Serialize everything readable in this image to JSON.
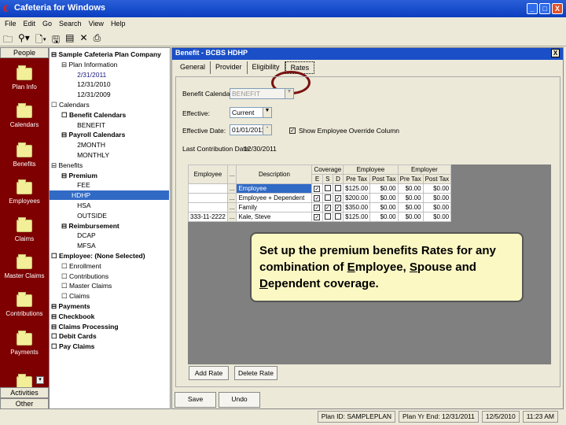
{
  "window": {
    "title": "Cafeteria for Windows",
    "controls": [
      "_",
      "□",
      "X"
    ]
  },
  "menu": [
    "File",
    "Edit",
    "Go",
    "Search",
    "View",
    "Help"
  ],
  "sidebar": {
    "header": "People",
    "items": [
      "Plan Info",
      "Calendars",
      "Benefits",
      "Employees",
      "Claims",
      "Master Claims",
      "Contributions",
      "Payments"
    ],
    "bottom": [
      "Activities",
      "Other"
    ]
  },
  "tree": [
    {
      "t": "Sample Cafeteria Plan Company",
      "l": 0,
      "b": true,
      "e": "⊟"
    },
    {
      "t": "Plan Information",
      "l": 1,
      "e": "⊟"
    },
    {
      "t": "2/31/2011",
      "l": 2,
      "c": "#1a1a80"
    },
    {
      "t": "12/31/2010",
      "l": 2
    },
    {
      "t": "12/31/2009",
      "l": 2
    },
    {
      "t": "Calendars",
      "l": 0,
      "e": "☐"
    },
    {
      "t": "Benefit Calendars",
      "l": 1,
      "b": true,
      "e": "☐"
    },
    {
      "t": "BENEFIT",
      "l": 2
    },
    {
      "t": "Payroll Calendars",
      "l": 1,
      "b": true,
      "e": "⊟"
    },
    {
      "t": "2MONTH",
      "l": 2
    },
    {
      "t": "MONTHLY",
      "l": 2
    },
    {
      "t": "Benefits",
      "l": 0,
      "e": "⊟"
    },
    {
      "t": "Premium",
      "l": 1,
      "b": true,
      "e": "⊟"
    },
    {
      "t": "FEE",
      "l": 2
    },
    {
      "t": "HDHP",
      "l": 2,
      "sel": true
    },
    {
      "t": "HSA",
      "l": 2
    },
    {
      "t": "OUTSIDE",
      "l": 2
    },
    {
      "t": "Reimbursement",
      "l": 1,
      "b": true,
      "e": "⊟"
    },
    {
      "t": "DCAP",
      "l": 2
    },
    {
      "t": "MFSA",
      "l": 2
    },
    {
      "t": "Employee: (None Selected)",
      "l": 0,
      "b": true,
      "e": "☐"
    },
    {
      "t": "Enrollment",
      "l": 1,
      "e": "☐"
    },
    {
      "t": "Contributions",
      "l": 1,
      "e": "☐"
    },
    {
      "t": "Master Claims",
      "l": 1,
      "e": "☐"
    },
    {
      "t": "Claims",
      "l": 1,
      "e": "☐"
    },
    {
      "t": "Payments",
      "l": 0,
      "b": true,
      "e": "⊟"
    },
    {
      "t": "Checkbook",
      "l": 0,
      "b": true,
      "e": "⊟"
    },
    {
      "t": "Claims Processing",
      "l": 0,
      "b": true,
      "e": "⊟"
    },
    {
      "t": "Debit Cards",
      "l": 0,
      "b": true,
      "e": "☐"
    },
    {
      "t": "Pay Claims",
      "l": 0,
      "b": true,
      "e": "☐"
    }
  ],
  "panel": {
    "title": "Benefit - BCBS HDHP",
    "close": "X",
    "tabs": [
      "General",
      "Provider",
      "Eligibility",
      "Rates"
    ],
    "form": {
      "calendar_label": "Benefit Calendar:",
      "calendar_value": "BENEFIT",
      "effective_label": "Effective:",
      "effective_value": "Current",
      "date_label": "Effective Date:",
      "date_value": "01/01/2011",
      "override_label": "Show Employee Override Column",
      "last_label": "Last Contribution Date:",
      "last_value": "12/30/2011"
    },
    "grid": {
      "headers": {
        "employee": "Employee",
        "dots": "...",
        "description": "Description",
        "coverage": "Coverage",
        "employee_grp": "Employee",
        "employer_grp": "Employer",
        "e": "E",
        "s": "S",
        "d": "D",
        "pre": "Pre Tax",
        "post": "Post Tax"
      },
      "rows": [
        {
          "emp": "",
          "desc": "Employee",
          "e": true,
          "s": false,
          "d": false,
          "ee_pre": "$125.00",
          "ee_post": "$0.00",
          "er_pre": "$0.00",
          "er_post": "$0.00",
          "sel": true
        },
        {
          "emp": "",
          "desc": "Employee + Dependent",
          "e": true,
          "s": false,
          "d": true,
          "ee_pre": "$200.00",
          "ee_post": "$0.00",
          "er_pre": "$0.00",
          "er_post": "$0.00"
        },
        {
          "emp": "",
          "desc": "Family",
          "e": true,
          "s": true,
          "d": true,
          "ee_pre": "$350.00",
          "ee_post": "$0.00",
          "er_pre": "$0.00",
          "er_post": "$0.00"
        },
        {
          "emp": "333-11-2222",
          "desc": "Kale, Steve",
          "e": true,
          "s": false,
          "d": false,
          "ee_pre": "$125.00",
          "ee_post": "$0.00",
          "er_pre": "$0.00",
          "er_post": "$0.00"
        }
      ]
    },
    "add_rate": "Add Rate",
    "delete_rate": "Delete Rate",
    "save": "Save",
    "undo": "Undo"
  },
  "callout": {
    "p1": "Set up the premium benefits Rates for any combination of ",
    "u1": "E",
    "p2": "mployee, ",
    "u2": "S",
    "p3": "pouse and ",
    "u3": "D",
    "p4": "ependent coverage."
  },
  "status": [
    "Plan ID: SAMPLEPLAN",
    "Plan Yr End: 12/31/2011",
    "12/5/2010",
    "11:23 AM"
  ]
}
